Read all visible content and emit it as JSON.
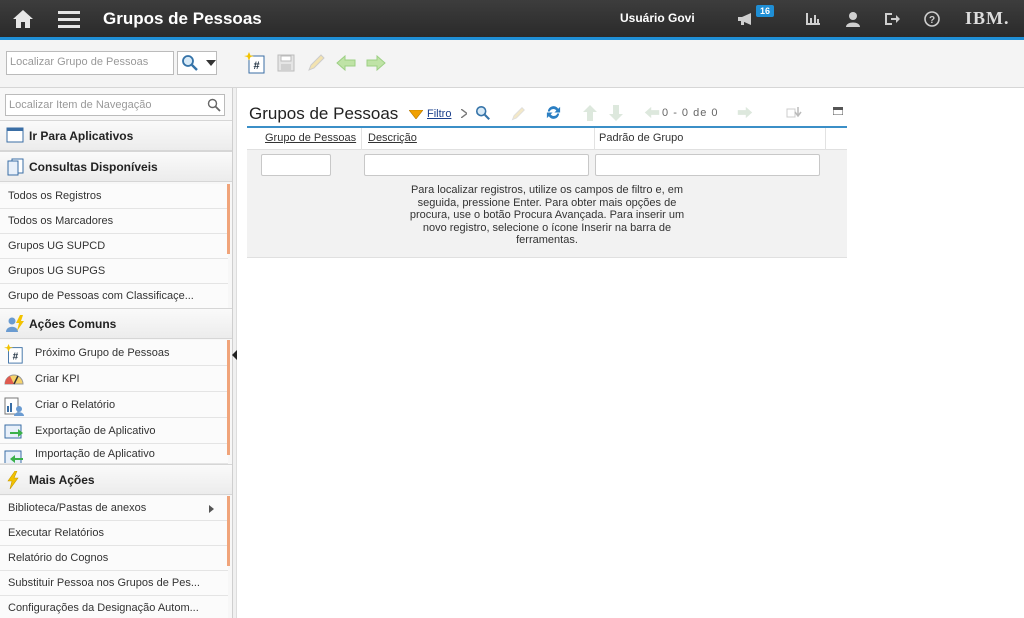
{
  "header": {
    "title": "Grupos de Pessoas",
    "user": "Usuário Govi",
    "notifications": "16",
    "brand": "IBM."
  },
  "toolbar": {
    "search_placeholder": "Localizar Grupo de Pessoas"
  },
  "sidebar": {
    "nav_search_placeholder": "Localizar Item de Navegação",
    "section_apps": "Ir Para Aplicativos",
    "section_queries": "Consultas Disponíveis",
    "queries": [
      "Todos os Registros",
      "Todos os Marcadores",
      "Grupos UG SUPCD",
      "Grupos UG SUPGS",
      "Grupo de Pessoas com Classificaçe..."
    ],
    "section_common": "Ações Comuns",
    "common": [
      "Próximo Grupo de Pessoas",
      "Criar KPI",
      "Criar o Relatório",
      "Exportação de Aplicativo",
      "Importação de Aplicativo"
    ],
    "section_more": "Mais Ações",
    "more": [
      "Biblioteca/Pastas de anexos",
      "Executar Relatórios",
      "Relatório do Cognos",
      "Substituir Pessoa nos Grupos de Pes...",
      "Configurações da Designação Autom..."
    ]
  },
  "main": {
    "title": "Grupos de Pessoas",
    "filter_label": "Filtro",
    "pager": {
      "from": "0",
      "dash": "-",
      "to": "0",
      "of": "de",
      "total": "0"
    },
    "columns": [
      "Grupo de Pessoas",
      "Descrição",
      "Padrão de Grupo"
    ],
    "message": "Para localizar registros, utilize os campos de filtro e, em seguida, pressione Enter. Para obter mais opções de procura, use o botão Procura Avançada. Para inserir um novo registro, selecione o ícone Inserir na barra de ferramentas."
  }
}
